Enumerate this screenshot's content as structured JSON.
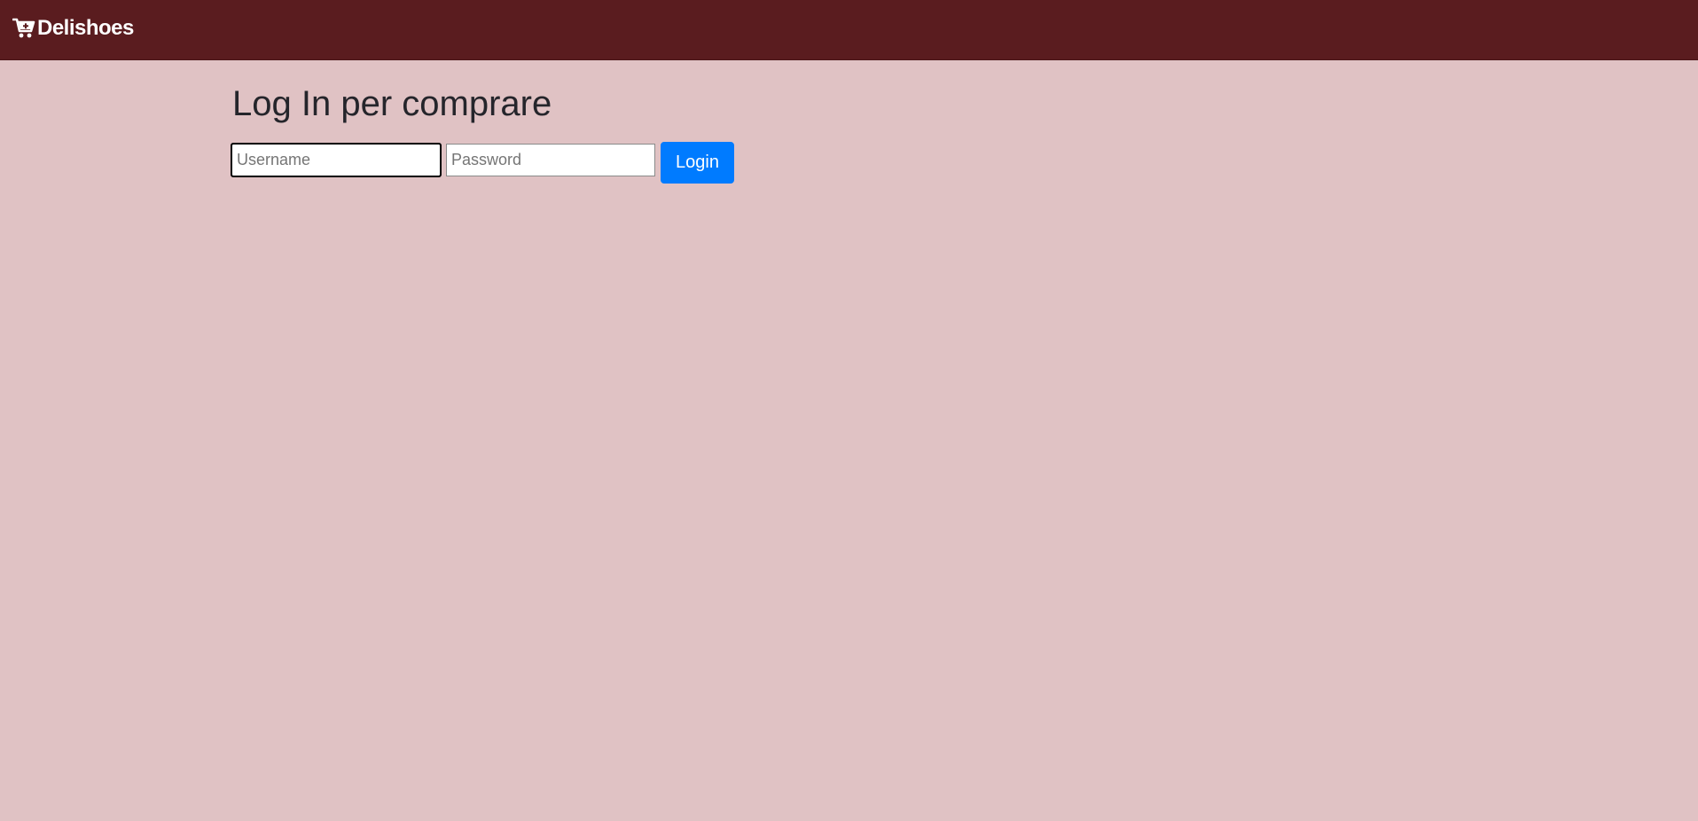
{
  "navbar": {
    "brand_label": "Delishoes",
    "brand_icon": "cart-plus-icon",
    "background_color": "#5a1c1f"
  },
  "page": {
    "background_color": "#e0c2c4",
    "title": "Log In per comprare"
  },
  "login_form": {
    "username": {
      "value": "",
      "placeholder": "Username",
      "focused": true
    },
    "password": {
      "value": "",
      "placeholder": "Password"
    },
    "submit_label": "Login",
    "submit_color": "#007bff"
  }
}
